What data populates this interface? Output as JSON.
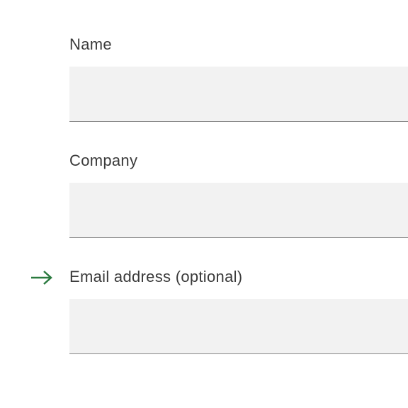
{
  "form": {
    "fields": [
      {
        "label": "Name",
        "value": "",
        "optional": false,
        "indicated": false
      },
      {
        "label": "Company",
        "value": "",
        "optional": false,
        "indicated": false
      },
      {
        "label": "Email address (optional)",
        "value": "",
        "optional": true,
        "indicated": true
      }
    ]
  },
  "colors": {
    "arrow": "#2a7a3f",
    "input_bg": "#f2f2f2",
    "input_border": "#888888",
    "label": "#3a3a3a"
  }
}
